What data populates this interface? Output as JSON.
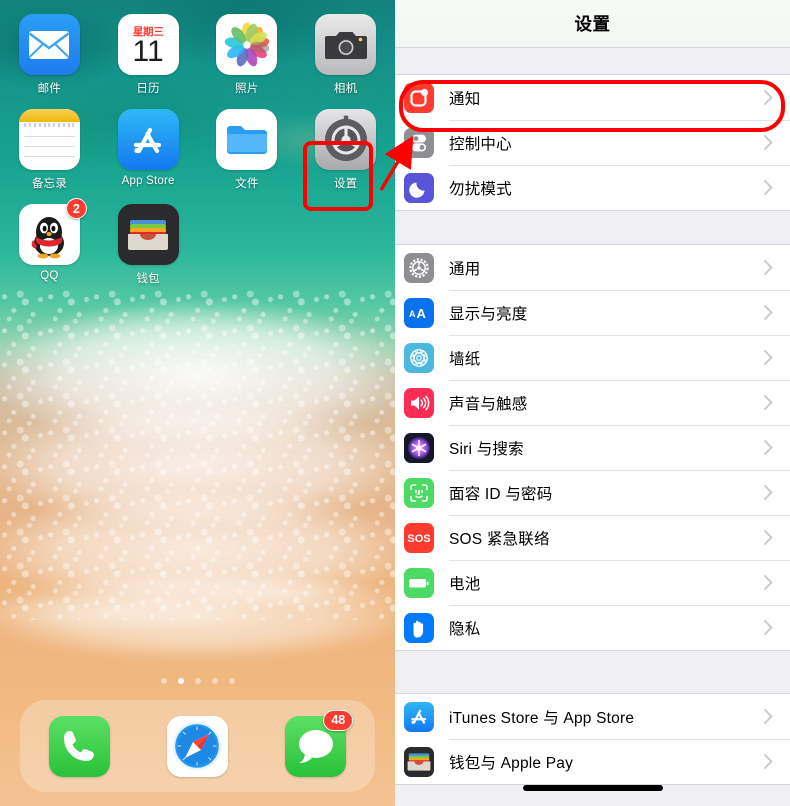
{
  "home_screen": {
    "wallpaper_name": "ios11-beach-wallpaper",
    "apps": [
      {
        "label": "邮件",
        "icon": "mail-icon",
        "badge": null
      },
      {
        "label": "日历",
        "icon": "calendar-icon",
        "badge": null,
        "calendar_weekday": "星期三",
        "calendar_day": "11"
      },
      {
        "label": "照片",
        "icon": "photos-icon",
        "badge": null
      },
      {
        "label": "相机",
        "icon": "camera-icon",
        "badge": null
      },
      {
        "label": "备忘录",
        "icon": "notes-icon",
        "badge": null
      },
      {
        "label": "App Store",
        "icon": "appstore-icon",
        "badge": null
      },
      {
        "label": "文件",
        "icon": "files-icon",
        "badge": null
      },
      {
        "label": "设置",
        "icon": "settings-gear-icon",
        "badge": null
      },
      {
        "label": "QQ",
        "icon": "qq-penguin-icon",
        "badge": "2"
      },
      {
        "label": "钱包",
        "icon": "wallet-icon",
        "badge": null
      }
    ],
    "page_dots": {
      "count": 5,
      "active_index": 1
    },
    "dock": [
      {
        "label": "电话",
        "icon": "phone-icon",
        "badge": null
      },
      {
        "label": "Safari",
        "icon": "safari-icon",
        "badge": null
      },
      {
        "label": "信息",
        "icon": "messages-icon",
        "badge": "48"
      }
    ]
  },
  "settings": {
    "nav_title": "设置",
    "chevron": "chevron-right-icon",
    "groups": [
      {
        "rows": [
          {
            "label": "通知",
            "icon": "notifications-icon",
            "icon_color": "#ff3b30"
          },
          {
            "label": "控制中心",
            "icon": "control-center-icon",
            "icon_color": "#8e8e93"
          },
          {
            "label": "勿扰模式",
            "icon": "do-not-disturb-icon",
            "icon_color": "#5856d6"
          }
        ]
      },
      {
        "rows": [
          {
            "label": "通用",
            "icon": "general-gear-icon",
            "icon_color": "#8e8e93"
          },
          {
            "label": "显示与亮度",
            "icon": "display-brightness-icon",
            "icon_color": "#007aff"
          },
          {
            "label": "墙纸",
            "icon": "wallpaper-icon",
            "icon_color": "#4cb8e0"
          },
          {
            "label": "声音与触感",
            "icon": "sounds-haptics-icon",
            "icon_color": "#fc2c55"
          },
          {
            "label": "Siri 与搜索",
            "icon": "siri-icon",
            "icon_color": "#1c1c2e"
          },
          {
            "label": "面容 ID 与密码",
            "icon": "face-id-icon",
            "icon_color": "#4cd964"
          },
          {
            "label": "SOS 紧急联络",
            "icon": "sos-icon",
            "icon_color": "#ff3b30"
          },
          {
            "label": "电池",
            "icon": "battery-icon",
            "icon_color": "#4cd964"
          },
          {
            "label": "隐私",
            "icon": "privacy-hand-icon",
            "icon_color": "#007aff"
          }
        ]
      },
      {
        "rows": [
          {
            "label": "iTunes Store 与 App Store",
            "icon": "appstore-icon",
            "icon_color": "#1e9bf5"
          },
          {
            "label": "钱包与 Apple Pay",
            "icon": "wallet-icon",
            "icon_color": "#2b2b2d"
          }
        ]
      }
    ]
  },
  "annotations": {
    "highlight_color": "#ff0000",
    "boxes": [
      {
        "name": "settings-app-highlight",
        "target": "设置"
      },
      {
        "name": "notifications-row-highlight",
        "target": "通知"
      }
    ],
    "arrow": {
      "name": "pointer-arrow",
      "from": "设置",
      "to": "通知"
    }
  }
}
